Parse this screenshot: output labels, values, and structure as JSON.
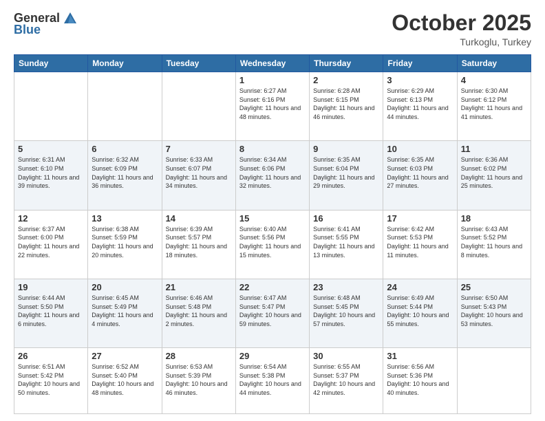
{
  "header": {
    "logo_general": "General",
    "logo_blue": "Blue",
    "month": "October 2025",
    "location": "Turkoglu, Turkey"
  },
  "days_of_week": [
    "Sunday",
    "Monday",
    "Tuesday",
    "Wednesday",
    "Thursday",
    "Friday",
    "Saturday"
  ],
  "weeks": [
    [
      {
        "day": "",
        "sunrise": "",
        "sunset": "",
        "daylight": "",
        "empty": true
      },
      {
        "day": "",
        "sunrise": "",
        "sunset": "",
        "daylight": "",
        "empty": true
      },
      {
        "day": "",
        "sunrise": "",
        "sunset": "",
        "daylight": "",
        "empty": true
      },
      {
        "day": "1",
        "sunrise": "Sunrise: 6:27 AM",
        "sunset": "Sunset: 6:16 PM",
        "daylight": "Daylight: 11 hours and 48 minutes."
      },
      {
        "day": "2",
        "sunrise": "Sunrise: 6:28 AM",
        "sunset": "Sunset: 6:15 PM",
        "daylight": "Daylight: 11 hours and 46 minutes."
      },
      {
        "day": "3",
        "sunrise": "Sunrise: 6:29 AM",
        "sunset": "Sunset: 6:13 PM",
        "daylight": "Daylight: 11 hours and 44 minutes."
      },
      {
        "day": "4",
        "sunrise": "Sunrise: 6:30 AM",
        "sunset": "Sunset: 6:12 PM",
        "daylight": "Daylight: 11 hours and 41 minutes."
      }
    ],
    [
      {
        "day": "5",
        "sunrise": "Sunrise: 6:31 AM",
        "sunset": "Sunset: 6:10 PM",
        "daylight": "Daylight: 11 hours and 39 minutes."
      },
      {
        "day": "6",
        "sunrise": "Sunrise: 6:32 AM",
        "sunset": "Sunset: 6:09 PM",
        "daylight": "Daylight: 11 hours and 36 minutes."
      },
      {
        "day": "7",
        "sunrise": "Sunrise: 6:33 AM",
        "sunset": "Sunset: 6:07 PM",
        "daylight": "Daylight: 11 hours and 34 minutes."
      },
      {
        "day": "8",
        "sunrise": "Sunrise: 6:34 AM",
        "sunset": "Sunset: 6:06 PM",
        "daylight": "Daylight: 11 hours and 32 minutes."
      },
      {
        "day": "9",
        "sunrise": "Sunrise: 6:35 AM",
        "sunset": "Sunset: 6:04 PM",
        "daylight": "Daylight: 11 hours and 29 minutes."
      },
      {
        "day": "10",
        "sunrise": "Sunrise: 6:35 AM",
        "sunset": "Sunset: 6:03 PM",
        "daylight": "Daylight: 11 hours and 27 minutes."
      },
      {
        "day": "11",
        "sunrise": "Sunrise: 6:36 AM",
        "sunset": "Sunset: 6:02 PM",
        "daylight": "Daylight: 11 hours and 25 minutes."
      }
    ],
    [
      {
        "day": "12",
        "sunrise": "Sunrise: 6:37 AM",
        "sunset": "Sunset: 6:00 PM",
        "daylight": "Daylight: 11 hours and 22 minutes."
      },
      {
        "day": "13",
        "sunrise": "Sunrise: 6:38 AM",
        "sunset": "Sunset: 5:59 PM",
        "daylight": "Daylight: 11 hours and 20 minutes."
      },
      {
        "day": "14",
        "sunrise": "Sunrise: 6:39 AM",
        "sunset": "Sunset: 5:57 PM",
        "daylight": "Daylight: 11 hours and 18 minutes."
      },
      {
        "day": "15",
        "sunrise": "Sunrise: 6:40 AM",
        "sunset": "Sunset: 5:56 PM",
        "daylight": "Daylight: 11 hours and 15 minutes."
      },
      {
        "day": "16",
        "sunrise": "Sunrise: 6:41 AM",
        "sunset": "Sunset: 5:55 PM",
        "daylight": "Daylight: 11 hours and 13 minutes."
      },
      {
        "day": "17",
        "sunrise": "Sunrise: 6:42 AM",
        "sunset": "Sunset: 5:53 PM",
        "daylight": "Daylight: 11 hours and 11 minutes."
      },
      {
        "day": "18",
        "sunrise": "Sunrise: 6:43 AM",
        "sunset": "Sunset: 5:52 PM",
        "daylight": "Daylight: 11 hours and 8 minutes."
      }
    ],
    [
      {
        "day": "19",
        "sunrise": "Sunrise: 6:44 AM",
        "sunset": "Sunset: 5:50 PM",
        "daylight": "Daylight: 11 hours and 6 minutes."
      },
      {
        "day": "20",
        "sunrise": "Sunrise: 6:45 AM",
        "sunset": "Sunset: 5:49 PM",
        "daylight": "Daylight: 11 hours and 4 minutes."
      },
      {
        "day": "21",
        "sunrise": "Sunrise: 6:46 AM",
        "sunset": "Sunset: 5:48 PM",
        "daylight": "Daylight: 11 hours and 2 minutes."
      },
      {
        "day": "22",
        "sunrise": "Sunrise: 6:47 AM",
        "sunset": "Sunset: 5:47 PM",
        "daylight": "Daylight: 10 hours and 59 minutes."
      },
      {
        "day": "23",
        "sunrise": "Sunrise: 6:48 AM",
        "sunset": "Sunset: 5:45 PM",
        "daylight": "Daylight: 10 hours and 57 minutes."
      },
      {
        "day": "24",
        "sunrise": "Sunrise: 6:49 AM",
        "sunset": "Sunset: 5:44 PM",
        "daylight": "Daylight: 10 hours and 55 minutes."
      },
      {
        "day": "25",
        "sunrise": "Sunrise: 6:50 AM",
        "sunset": "Sunset: 5:43 PM",
        "daylight": "Daylight: 10 hours and 53 minutes."
      }
    ],
    [
      {
        "day": "26",
        "sunrise": "Sunrise: 6:51 AM",
        "sunset": "Sunset: 5:42 PM",
        "daylight": "Daylight: 10 hours and 50 minutes."
      },
      {
        "day": "27",
        "sunrise": "Sunrise: 6:52 AM",
        "sunset": "Sunset: 5:40 PM",
        "daylight": "Daylight: 10 hours and 48 minutes."
      },
      {
        "day": "28",
        "sunrise": "Sunrise: 6:53 AM",
        "sunset": "Sunset: 5:39 PM",
        "daylight": "Daylight: 10 hours and 46 minutes."
      },
      {
        "day": "29",
        "sunrise": "Sunrise: 6:54 AM",
        "sunset": "Sunset: 5:38 PM",
        "daylight": "Daylight: 10 hours and 44 minutes."
      },
      {
        "day": "30",
        "sunrise": "Sunrise: 6:55 AM",
        "sunset": "Sunset: 5:37 PM",
        "daylight": "Daylight: 10 hours and 42 minutes."
      },
      {
        "day": "31",
        "sunrise": "Sunrise: 6:56 AM",
        "sunset": "Sunset: 5:36 PM",
        "daylight": "Daylight: 10 hours and 40 minutes."
      },
      {
        "day": "",
        "sunrise": "",
        "sunset": "",
        "daylight": "",
        "empty": true
      }
    ]
  ]
}
